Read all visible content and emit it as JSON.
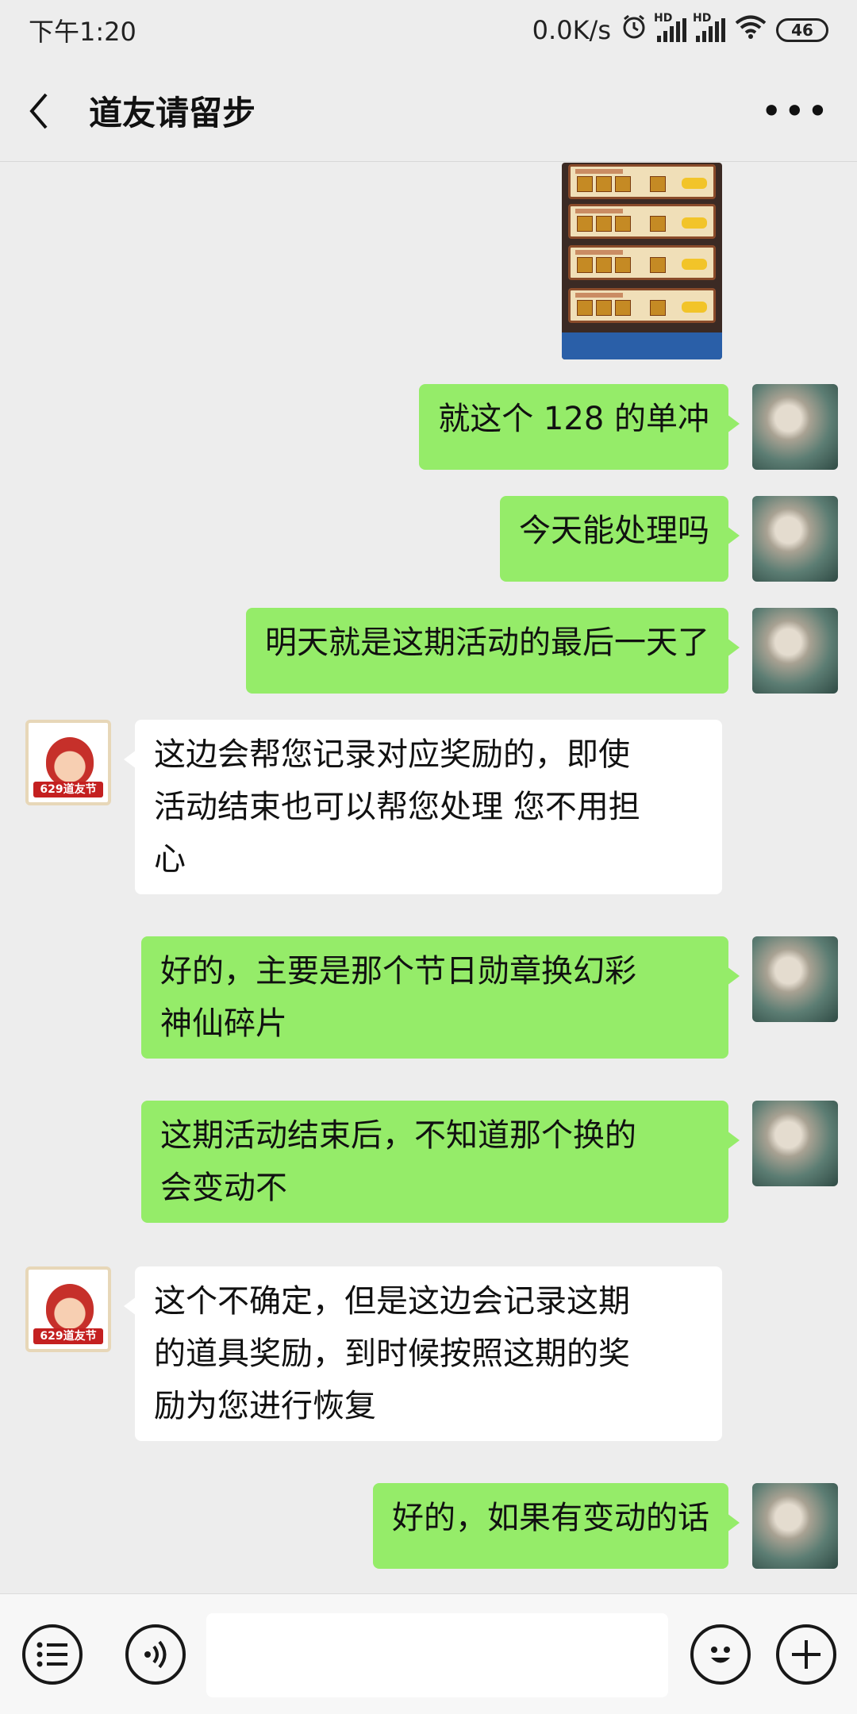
{
  "status_bar": {
    "time": "下午1:20",
    "net_speed": "0.0K/s",
    "hd1": "HD",
    "hd2": "HD",
    "battery": "46"
  },
  "header": {
    "title": "道友请留步"
  },
  "messages": [
    {
      "side": "right",
      "text": "就这个 128 的单冲"
    },
    {
      "side": "right",
      "text": "今天能处理吗"
    },
    {
      "side": "right",
      "text": "明天就是这期活动的最后一天了"
    },
    {
      "side": "left",
      "lines": [
        "这边会帮您记录对应奖励的，即使",
        "活动结束也可以帮您处理 您不用担",
        "心"
      ]
    },
    {
      "side": "right",
      "lines": [
        "好的，主要是那个节日勋章换幻彩",
        "神仙碎片"
      ]
    },
    {
      "side": "right",
      "lines": [
        "这期活动结束后，不知道那个换的",
        "会变动不"
      ]
    },
    {
      "side": "left",
      "lines": [
        "这个不确定，但是这边会记录这期",
        "的道具奖励，到时候按照这期的奖",
        "励为您进行恢复"
      ]
    },
    {
      "side": "right",
      "text": "好的，如果有变动的话"
    }
  ],
  "service_avatar_label": "629道友节",
  "colors": {
    "sent_bubble": "#95ec69",
    "received_bubble": "#ffffff",
    "background": "#ededed"
  },
  "input_bar": {
    "icons": [
      "list-icon",
      "voice-icon",
      "emoji-icon",
      "plus-icon"
    ]
  }
}
